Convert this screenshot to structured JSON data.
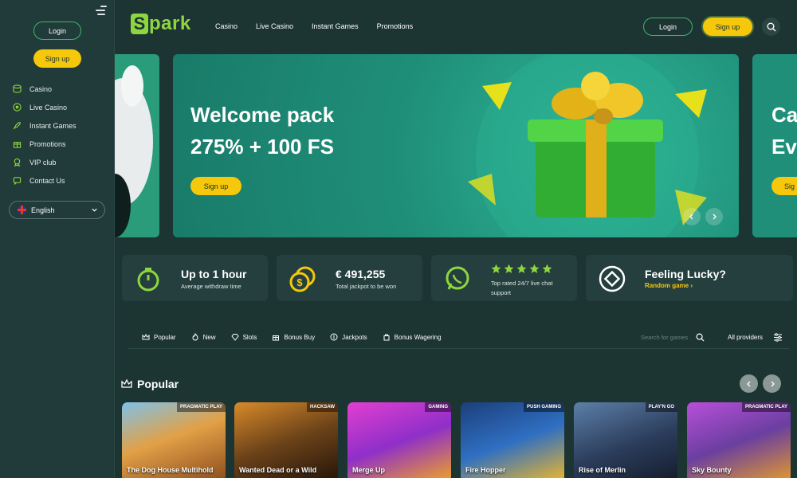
{
  "sidebar": {
    "login_label": "Login",
    "signup_label": "Sign up",
    "items": [
      {
        "label": "Casino",
        "icon": "coins-icon"
      },
      {
        "label": "Live Casino",
        "icon": "live-icon"
      },
      {
        "label": "Instant Games",
        "icon": "rocket-icon"
      },
      {
        "label": "Promotions",
        "icon": "gift-icon"
      },
      {
        "label": "VIP club",
        "icon": "medal-icon"
      },
      {
        "label": "Contact Us",
        "icon": "chat-icon"
      }
    ],
    "language": "English"
  },
  "header": {
    "logo_initial": "S",
    "logo_text": "park",
    "nav": [
      "Casino",
      "Live Casino",
      "Instant Games",
      "Promotions"
    ],
    "login_label": "Login",
    "signup_label": "Sign up"
  },
  "banner": {
    "title_line1": "Welcome pack",
    "title_line2": "275% + 100 FS",
    "cta": "Sign up",
    "next_title_line1": "Ca",
    "next_title_line2": "Ev",
    "next_cta": "Sig"
  },
  "info_cards": [
    {
      "title": "Up to 1 hour",
      "subtitle": "Average withdraw time",
      "icon": "timer-icon"
    },
    {
      "title": "€ 491,255",
      "subtitle": "Total jackpot to be won",
      "icon": "coins-icon"
    },
    {
      "subtitle": "Top rated 24/7 live chat support",
      "icon": "whatsapp-icon",
      "stars": 5
    },
    {
      "title": "Feeling Lucky?",
      "link": "Random game",
      "icon": "diamond-icon"
    }
  ],
  "filters": {
    "tabs": [
      "Popular",
      "New",
      "Slots",
      "Bonus Buy",
      "Jackpots",
      "Bonus Wagering"
    ],
    "search_placeholder": "Search for games",
    "providers_label": "All providers"
  },
  "popular": {
    "title": "Popular",
    "games": [
      {
        "name": "The Dog House Multihold",
        "provider": "PRAGMATIC PLAY",
        "color": "#c77b2b"
      },
      {
        "name": "Wanted Dead or a Wild",
        "provider": "HACKSAW",
        "color": "#8a5a23"
      },
      {
        "name": "Merge Up",
        "provider": "GAMING",
        "color": "#b13ad1"
      },
      {
        "name": "Fire Hopper",
        "provider": "PUSH GAMING",
        "color": "#2a5fa8"
      },
      {
        "name": "Rise of Merlin",
        "provider": "PLAY'N GO",
        "color": "#3f5a7e"
      },
      {
        "name": "Sky Bounty",
        "provider": "PRAGMATIC PLAY",
        "color": "#6a3fa0"
      }
    ]
  },
  "colors": {
    "accent_yellow": "#f5c80b",
    "accent_green": "#8ed63f",
    "background": "#1c3533"
  }
}
